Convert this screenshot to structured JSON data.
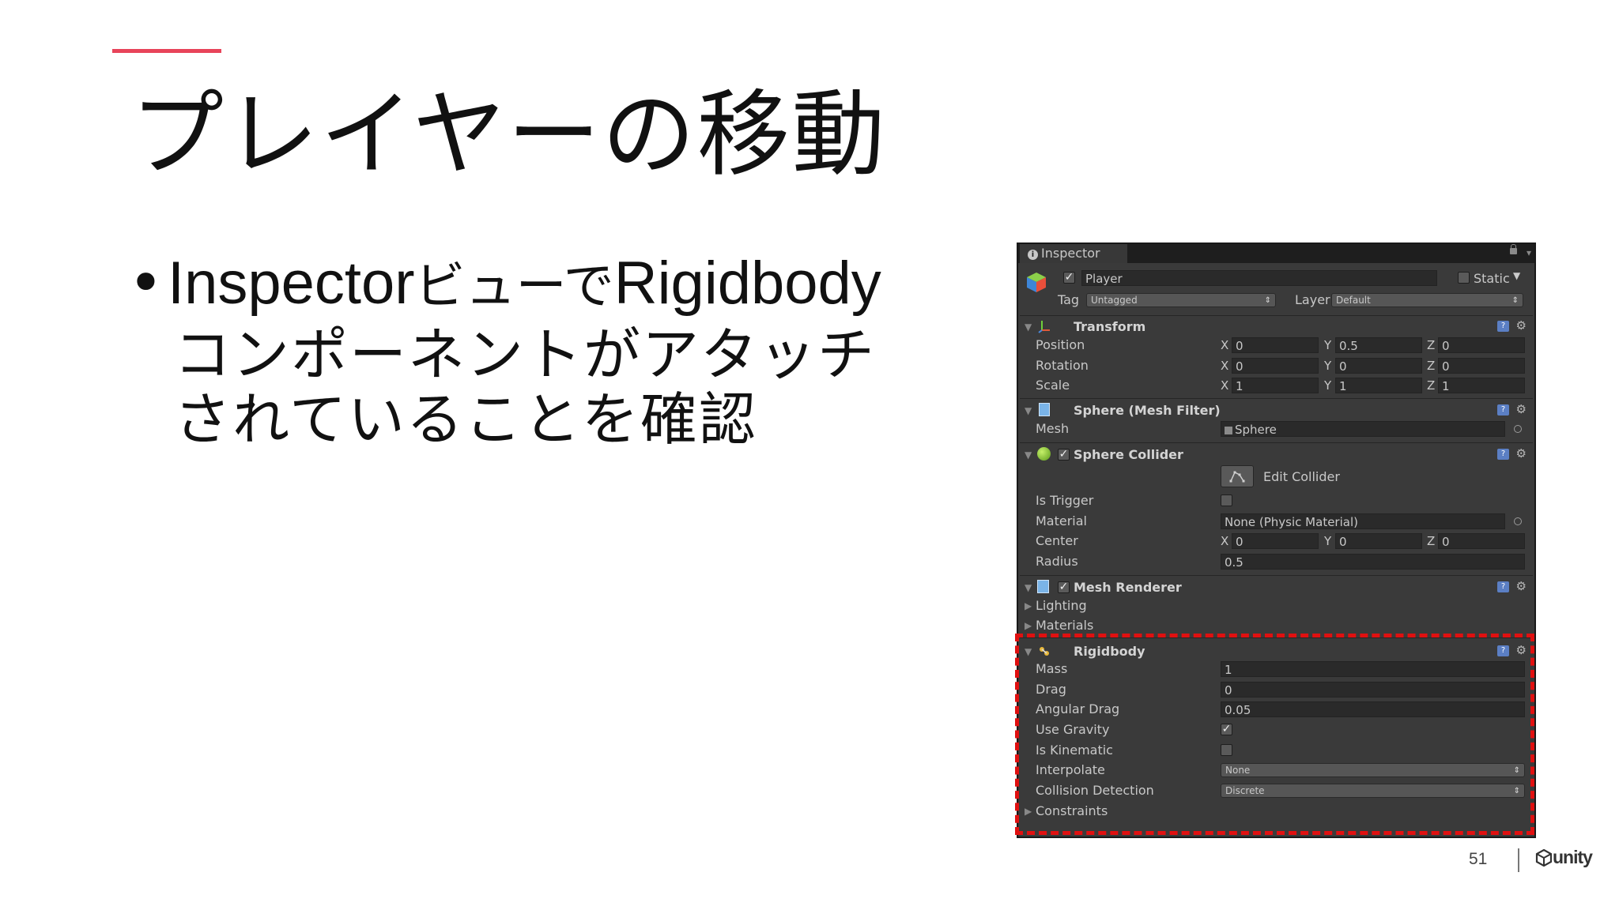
{
  "slide": {
    "title": "プレイヤーの移動",
    "bullet": {
      "line1_latin_a": "Inspector",
      "line1_jp": "ビューで",
      "line1_latin_b": "Rigidbody",
      "line2": "コンポーネントがアタッチ",
      "line3": "されていることを確認"
    },
    "page_number": "51",
    "logo_text": "unity",
    "accent_color": "#e8445a",
    "highlight_color": "#e01010"
  },
  "inspector": {
    "tab_label": "Inspector",
    "object": {
      "name": "Player",
      "active": true,
      "static_label": "Static",
      "static": false,
      "tag_label": "Tag",
      "tag_value": "Untagged",
      "layer_label": "Layer",
      "layer_value": "Default"
    },
    "transform": {
      "title": "Transform",
      "position_label": "Position",
      "rotation_label": "Rotation",
      "scale_label": "Scale",
      "axis_x": "X",
      "axis_y": "Y",
      "axis_z": "Z",
      "position": [
        "0",
        "0.5",
        "0"
      ],
      "rotation": [
        "0",
        "0",
        "0"
      ],
      "scale": [
        "1",
        "1",
        "1"
      ]
    },
    "mesh_filter": {
      "title": "Sphere (Mesh Filter)",
      "mesh_label": "Mesh",
      "mesh_value": "Sphere"
    },
    "sphere_collider": {
      "title": "Sphere Collider",
      "enabled": true,
      "edit_collider_label": "Edit Collider",
      "is_trigger_label": "Is Trigger",
      "is_trigger": false,
      "material_label": "Material",
      "material_value": "None (Physic Material)",
      "center_label": "Center",
      "center": [
        "0",
        "0",
        "0"
      ],
      "radius_label": "Radius",
      "radius_value": "0.5"
    },
    "mesh_renderer": {
      "title": "Mesh Renderer",
      "enabled": true,
      "lighting_label": "Lighting",
      "materials_label": "Materials"
    },
    "rigidbody": {
      "title": "Rigidbody",
      "mass_label": "Mass",
      "mass_value": "1",
      "drag_label": "Drag",
      "drag_value": "0",
      "angular_drag_label": "Angular Drag",
      "angular_drag_value": "0.05",
      "use_gravity_label": "Use Gravity",
      "use_gravity": true,
      "is_kinematic_label": "Is Kinematic",
      "is_kinematic": false,
      "interpolate_label": "Interpolate",
      "interpolate_value": "None",
      "collision_detection_label": "Collision Detection",
      "collision_detection_value": "Discrete",
      "constraints_label": "Constraints"
    }
  }
}
